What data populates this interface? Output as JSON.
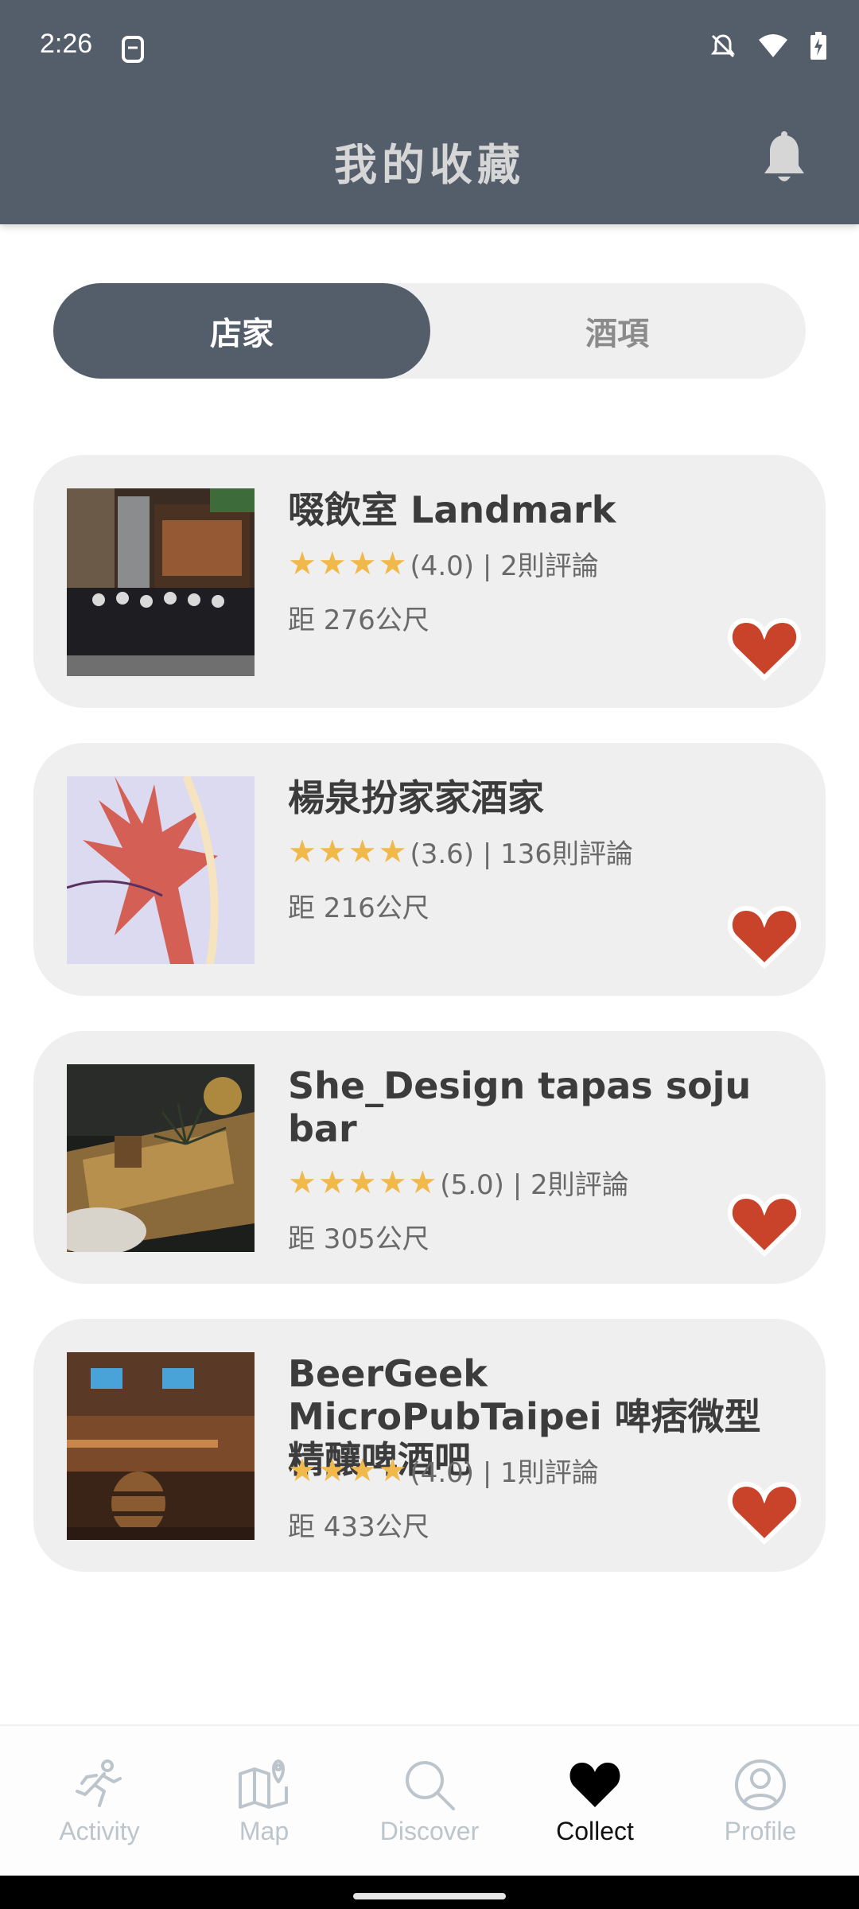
{
  "status_bar": {
    "time": "2:26"
  },
  "header": {
    "title": "我的收藏"
  },
  "toggle": {
    "active_label": "店家",
    "inactive_label": "酒項"
  },
  "colors": {
    "header_bg": "#545e6a",
    "star": "#f0b94a",
    "heart": "#c8432a",
    "card_bg": "#efefef",
    "nav_inactive": "#bcc4cc"
  },
  "favorites": [
    {
      "name": "啜飲室 Landmark",
      "stars": "★★★★",
      "rating": "(4.0) | 2則評論",
      "distance": "距 276公尺",
      "icon": "heart-icon"
    },
    {
      "name": "楊泉扮家家酒家",
      "stars": "★★★★",
      "rating": "(3.6) | 136則評論",
      "distance": "距 216公尺",
      "icon": "heart-icon"
    },
    {
      "name": "She_Design tapas soju bar",
      "stars": "★★★★★",
      "rating": "(5.0) | 2則評論",
      "distance": "距 305公尺",
      "icon": "heart-icon"
    },
    {
      "name": "BeerGeek MicroPubTaipei 啤痞微型精釀啤酒吧",
      "stars": "★★★★",
      "rating": "(4.0) | 1則評論",
      "distance": "距 433公尺",
      "icon": "heart-icon"
    }
  ],
  "nav": [
    {
      "label": "Activity",
      "icon": "running-person-icon"
    },
    {
      "label": "Map",
      "icon": "map-icon"
    },
    {
      "label": "Discover",
      "icon": "search-icon"
    },
    {
      "label": "Collect",
      "icon": "heart-icon",
      "active": true
    },
    {
      "label": "Profile",
      "icon": "profile-icon"
    }
  ]
}
